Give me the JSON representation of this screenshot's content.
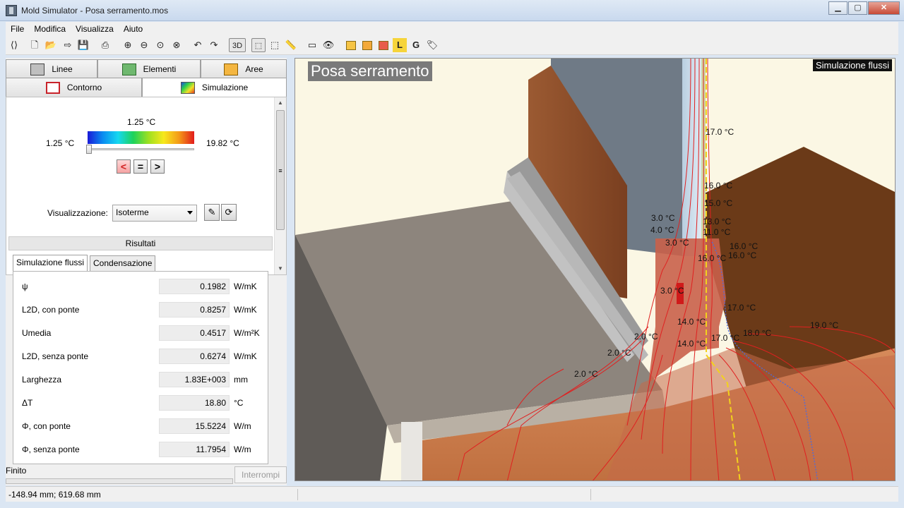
{
  "window": {
    "title": "Mold Simulator - Posa serramento.mos",
    "min_glyph": "▁",
    "max_glyph": "▢",
    "close_glyph": "✕"
  },
  "menu": [
    "File",
    "Modifica",
    "Visualizza",
    "Aiuto"
  ],
  "toolbar": {
    "glyphs": {
      "pan": "⟨⟩",
      "new": "🗋",
      "open": "📂",
      "export": "⇨",
      "save": "💾",
      "print": "⎙",
      "zoom_in": "⊕",
      "zoom_out": "⊖",
      "zoom_fit": "⊙",
      "zoom_reset": "⊗",
      "undo": "↶",
      "redo": "↷",
      "select": "⬚",
      "select2": "⬚",
      "measure": "📏",
      "comment": "▭",
      "eye": "👁",
      "l_tool": "L",
      "g_tool": "G",
      "tag": "🏷"
    },
    "view3d_label": "3D"
  },
  "tabs_row1": [
    {
      "label": "Linee",
      "icon": "lines-icon"
    },
    {
      "label": "Elementi",
      "icon": "elements-icon"
    },
    {
      "label": "Aree",
      "icon": "areas-icon"
    }
  ],
  "tabs_row2": [
    {
      "label": "Contorno",
      "icon": "contour-icon"
    },
    {
      "label": "Simulazione",
      "icon": "simulation-icon"
    }
  ],
  "scale": {
    "current": "1.25 °C",
    "min": "1.25 °C",
    "max": "19.82 °C",
    "slider_position": 0.0
  },
  "nav_buttons": {
    "prev": "<",
    "eq": "=",
    "next": ">"
  },
  "visual_label": "Visualizzazione:",
  "visual_value": "Isoterme",
  "side_glyphs": {
    "picker": "✎",
    "refresh": "⟳"
  },
  "scroll_glyphs": {
    "up": "▲",
    "down": "▼",
    "grip": "≡"
  },
  "results": {
    "header": "Risultati",
    "subtabs": [
      "Simulazione flussi",
      "Condensazione"
    ],
    "rows": [
      {
        "label": "ψ",
        "value": "0.1982",
        "unit": "W/mK"
      },
      {
        "label": "L2D, con ponte",
        "value": "0.8257",
        "unit": "W/mK"
      },
      {
        "label": "Umedia",
        "value": "0.4517",
        "unit": "W/m²K"
      },
      {
        "label": "L2D, senza ponte",
        "value": "0.6274",
        "unit": "W/mK"
      },
      {
        "label": "Larghezza",
        "value": "1.83E+003",
        "unit": "mm"
      },
      {
        "label": "ΔT",
        "value": "18.80",
        "unit": "°C"
      },
      {
        "label": "Φ, con ponte",
        "value": "15.5224",
        "unit": "W/m"
      },
      {
        "label": "Φ, senza ponte",
        "value": "11.7954",
        "unit": "W/m"
      }
    ]
  },
  "status": {
    "state": "Finito",
    "stop_button": "Interrompi",
    "coords": "-148.94 mm; 619.68 mm"
  },
  "viewport": {
    "title": "Posa serramento",
    "mode": "Simulazione flussi",
    "isotherms": [
      "17.0 °C",
      "16.0 °C",
      "15.0 °C",
      "13.0 °C",
      "11.0 °C",
      "3.0 °C",
      "4.0 °C",
      "3.0 °C",
      "16.0 °C",
      "16.0 °C",
      "16.0 °C",
      "3.0 °C",
      "17.0 °C",
      "14.0 °C",
      "14.0 °C",
      "17.0 °C",
      "18.0 °C",
      "19.0 °C",
      "2.0 °C",
      "2.0 °C",
      "2.0 °C"
    ]
  }
}
